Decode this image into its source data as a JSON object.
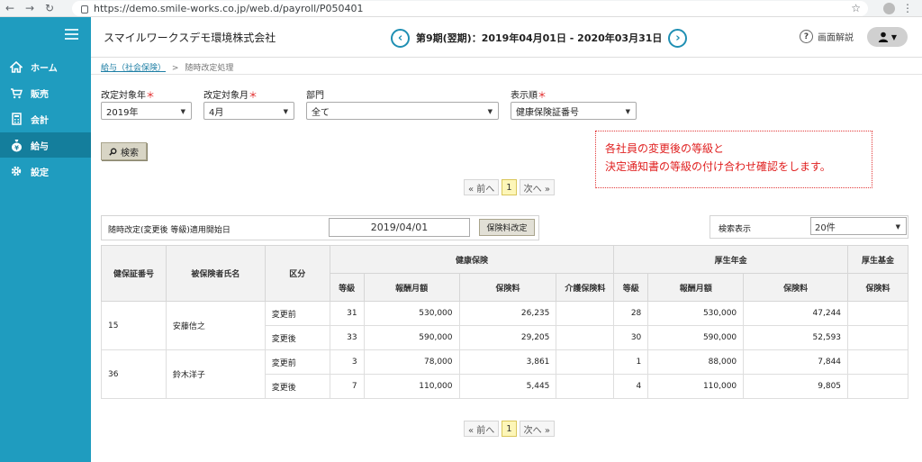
{
  "browser": {
    "url": "https://demo.smile-works.co.jp/web.d/payroll/P050401"
  },
  "sidebar": {
    "items": [
      {
        "label": "ホーム",
        "icon": "home-icon"
      },
      {
        "label": "販売",
        "icon": "cart-icon"
      },
      {
        "label": "会計",
        "icon": "calculator-icon"
      },
      {
        "label": "給与",
        "icon": "money-bag-icon"
      },
      {
        "label": "設定",
        "icon": "gear-icon"
      }
    ],
    "active_index": 3,
    "color": "#1f9cbf",
    "active_color": "#147e9c"
  },
  "header": {
    "company": "スマイルワークスデモ環境株式会社",
    "period": "第9期(翌期)：2019年04月01日 - 2020年03月31日",
    "prev_icon": "‹",
    "next_icon": "›",
    "help_label": "画面解説",
    "user_icon": "user-icon"
  },
  "breadcrumb": {
    "parent": "給与（社会保険）",
    "separator": ">",
    "current": "随時改定処理"
  },
  "filters": {
    "year": {
      "label": "改定対象年",
      "required": "＊",
      "value": "2019年"
    },
    "month": {
      "label": "改定対象月",
      "required": "＊",
      "value": "4月"
    },
    "dept": {
      "label": "部門",
      "value": "全て"
    },
    "order": {
      "label": "表示順",
      "required": "＊",
      "value": "健康保険証番号"
    }
  },
  "search_button": "検索",
  "note": {
    "line1": "各社員の変更後の等級と",
    "line2": "決定通知書の等級の付け合わせ確認をします。"
  },
  "pager": {
    "prev": "« 前へ",
    "current": "1",
    "next": "次へ »"
  },
  "date_row": {
    "label": "随時改定(変更後 等級)適用開始日",
    "value": "2019/04/01",
    "button": "保険料改定"
  },
  "per_page": {
    "label": "検索表示",
    "value": "20件"
  },
  "table": {
    "headers": {
      "id": "健保証番号",
      "name": "被保険者氏名",
      "kubun": "区分",
      "health": "健康保険",
      "pension": "厚生年金",
      "fund": "厚生基金",
      "grade": "等級",
      "monthly": "報酬月額",
      "premium": "保険料",
      "care": "介護保険料"
    },
    "rows": [
      {
        "id": "15",
        "name": "安藤信之",
        "before": {
          "kubun": "変更前",
          "h_grade": "31",
          "h_monthly": "530,000",
          "h_premium": "26,235",
          "care": "",
          "p_grade": "28",
          "p_monthly": "530,000",
          "p_premium": "47,244",
          "fund": ""
        },
        "after": {
          "kubun": "変更後",
          "h_grade": "33",
          "h_monthly": "590,000",
          "h_premium": "29,205",
          "care": "",
          "p_grade": "30",
          "p_monthly": "590,000",
          "p_premium": "52,593",
          "fund": ""
        }
      },
      {
        "id": "36",
        "name": "鈴木洋子",
        "before": {
          "kubun": "変更前",
          "h_grade": "3",
          "h_monthly": "78,000",
          "h_premium": "3,861",
          "care": "",
          "p_grade": "1",
          "p_monthly": "88,000",
          "p_premium": "7,844",
          "fund": ""
        },
        "after": {
          "kubun": "変更後",
          "h_grade": "7",
          "h_monthly": "110,000",
          "h_premium": "5,445",
          "care": "",
          "p_grade": "4",
          "p_monthly": "110,000",
          "p_premium": "9,805",
          "fund": ""
        }
      }
    ]
  }
}
